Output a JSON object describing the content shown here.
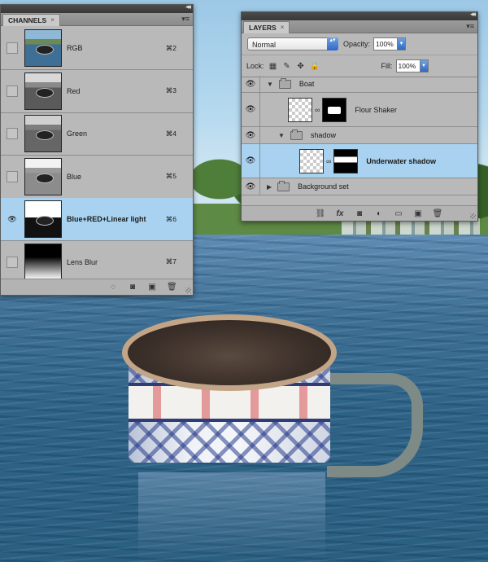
{
  "channels_panel": {
    "tab_label": "CHANNELS",
    "close_glyph": "×",
    "menu_glyph": "▾≡",
    "collapse_glyph": "◂◂",
    "rows": [
      {
        "name": "RGB",
        "shortcut": "⌘2",
        "visible": false,
        "selected": false,
        "thumb": "rgb"
      },
      {
        "name": "Red",
        "shortcut": "⌘3",
        "visible": false,
        "selected": false,
        "thumb": "red"
      },
      {
        "name": "Green",
        "shortcut": "⌘4",
        "visible": false,
        "selected": false,
        "thumb": "green"
      },
      {
        "name": "Blue",
        "shortcut": "⌘5",
        "visible": false,
        "selected": false,
        "thumb": "blue"
      },
      {
        "name": "Blue+RED+Linear light",
        "shortcut": "⌘6",
        "visible": true,
        "selected": true,
        "thumb": "bluered"
      },
      {
        "name": "Lens Blur",
        "shortcut": "⌘7",
        "visible": false,
        "selected": false,
        "thumb": "lens"
      }
    ],
    "footer_icons": [
      "dotted-circle-icon",
      "mask-icon",
      "new-channel-icon",
      "trash-icon"
    ],
    "footer_glyphs": [
      "◌",
      "◙",
      "▣",
      "🗑"
    ]
  },
  "layers_panel": {
    "tab_label": "LAYERS",
    "close_glyph": "×",
    "menu_glyph": "▾≡",
    "collapse_glyph": "◂◂",
    "blend_mode": "Normal",
    "opacity_label": "Opacity:",
    "opacity_value": "100%",
    "lock_label": "Lock:",
    "lock_icons": [
      "lock-transparency-icon",
      "lock-paint-icon",
      "lock-position-icon",
      "lock-all-icon"
    ],
    "lock_glyphs": [
      "▦",
      "✎",
      "✥",
      "🔒"
    ],
    "fill_label": "Fill:",
    "fill_value": "100%",
    "rows": [
      {
        "type": "group",
        "name": "Boat",
        "indent": 0,
        "expanded": true
      },
      {
        "type": "layer",
        "name": "Flour Shaker",
        "indent": 1
      },
      {
        "type": "group",
        "name": "shadow",
        "indent": 1,
        "expanded": true
      },
      {
        "type": "layer",
        "name": "Underwater shadow",
        "indent": 2,
        "selected": true
      },
      {
        "type": "group",
        "name": "Background set",
        "indent": 0,
        "expanded": false
      }
    ],
    "footer_icons": [
      "link-icon",
      "fx-icon",
      "add-mask-icon",
      "adjustment-icon",
      "new-group-icon",
      "new-layer-icon",
      "trash-icon"
    ],
    "footer_glyphs": [
      "⛓",
      "fx",
      "◙",
      "◐",
      "▭",
      "▣",
      "🗑"
    ]
  },
  "glyphs": {
    "eye": "👁",
    "expanded": "▼",
    "collapsed": "▶",
    "chain": "∞",
    "updown": "▴▾"
  }
}
